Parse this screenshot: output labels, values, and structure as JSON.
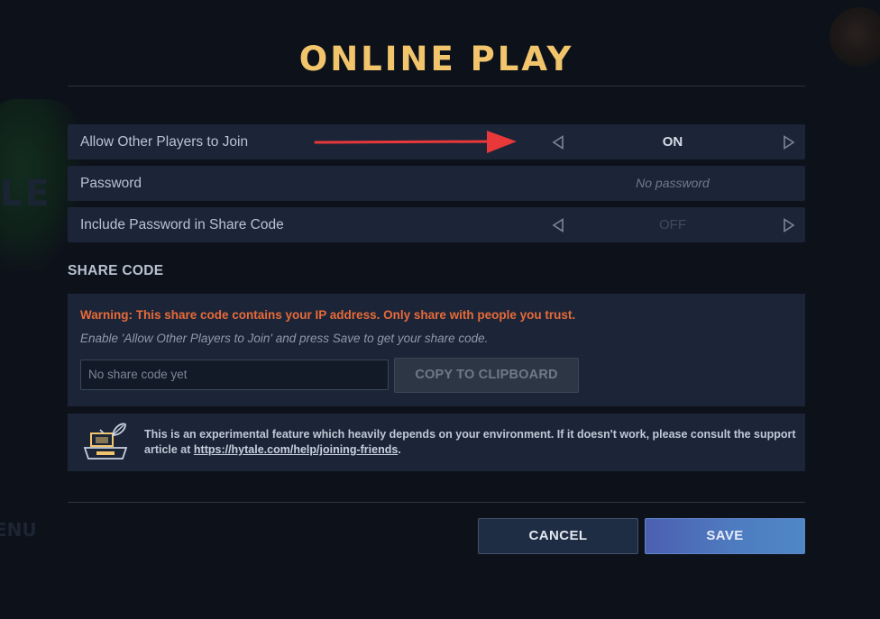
{
  "title": "ONLINE PLAY",
  "background": {
    "logo_fragment": "LE",
    "menu_fragment": "ENU"
  },
  "settings": {
    "allow_join": {
      "label": "Allow Other Players to Join",
      "value": "ON",
      "icon_prev": "triangle-left-icon",
      "icon_next": "triangle-right-icon"
    },
    "password": {
      "label": "Password",
      "placeholder": "No password"
    },
    "include_password": {
      "label": "Include Password in Share Code",
      "value": "OFF",
      "icon_prev": "triangle-left-icon",
      "icon_next": "triangle-right-icon"
    }
  },
  "share_code": {
    "section_title": "SHARE CODE",
    "warning": "Warning: This share code contains your IP address. Only share with people you trust.",
    "hint": "Enable 'Allow Other Players to Join' and press Save to get your share code.",
    "input_placeholder": "No share code yet",
    "copy_label": "COPY TO CLIPBOARD"
  },
  "info": {
    "icon": "experimental-feature-icon",
    "text": "This is an experimental feature which heavily depends on your environment. If it doesn't work, please consult the support article at ",
    "link": "https://hytale.com/help/joining-friends",
    "text_end": "."
  },
  "footer": {
    "cancel_label": "CANCEL",
    "save_label": "SAVE"
  },
  "colors": {
    "title": "#f2c56d",
    "warning": "#e86a3a",
    "annotation_arrow": "#e8383a",
    "row_bg": "#1b2537",
    "save_accent": "#4e7bc0"
  }
}
